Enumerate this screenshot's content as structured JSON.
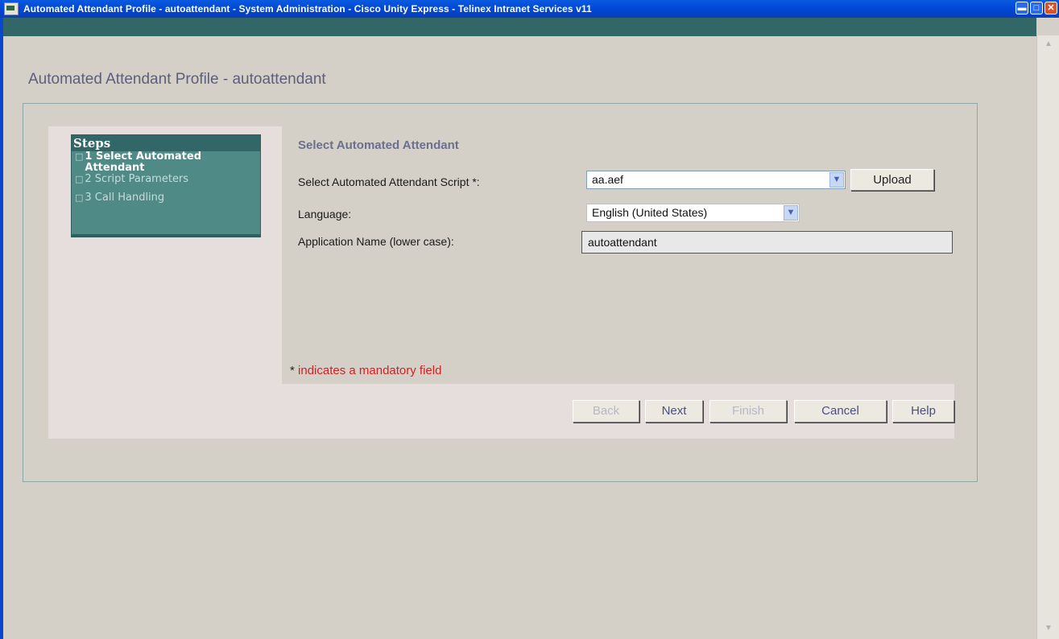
{
  "window": {
    "title": "Automated Attendant Profile - autoattendant - System Administration - Cisco Unity Express - Telinex Intranet Services v11",
    "buttons": {
      "minimize": "▬",
      "maximize": "□",
      "close": "✕"
    }
  },
  "page": {
    "title": "Automated Attendant Profile - autoattendant"
  },
  "steps": {
    "heading": "Steps",
    "items": [
      {
        "label": "1 Select Automated Attendant",
        "active": true
      },
      {
        "label": "2 Script Parameters",
        "active": false
      },
      {
        "label": "3 Call Handling",
        "active": false
      }
    ]
  },
  "form": {
    "section_title": "Select Automated Attendant",
    "script_label": "Select Automated Attendant Script *:",
    "script_value": "aa.aef",
    "upload_label": "Upload",
    "language_label": "Language:",
    "language_value": "English (United States)",
    "app_name_label": "Application Name (lower case):",
    "app_name_value": "autoattendant",
    "mandatory_star": "*",
    "mandatory_text": "indicates a mandatory field"
  },
  "buttons": {
    "back": "Back",
    "next": "Next",
    "finish": "Finish",
    "cancel": "Cancel",
    "help": "Help"
  },
  "icons": {
    "dropdown": "chevron-down-icon",
    "app": "browser-window-icon"
  },
  "colors": {
    "header_green": "#336666",
    "steps_bg": "#4f8a86",
    "title_purple": "#5c5f7a",
    "mandatory_red": "#d42020"
  }
}
